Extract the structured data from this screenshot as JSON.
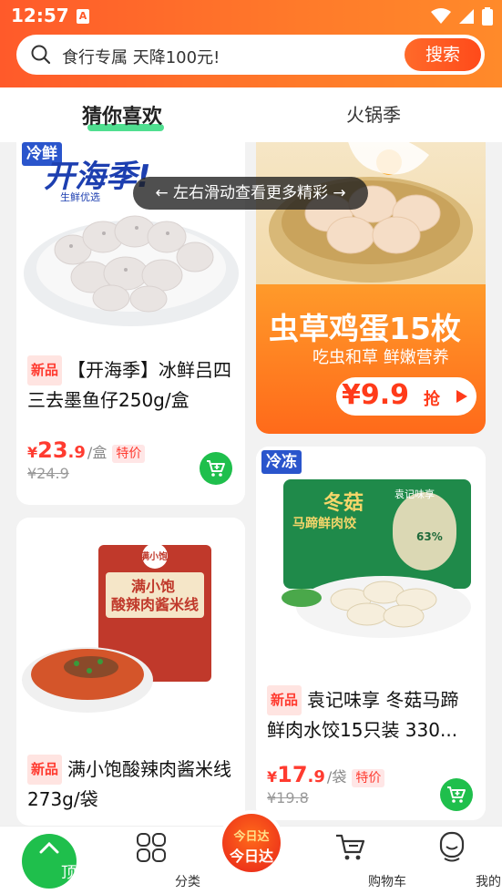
{
  "status_bar": {
    "time": "12:57",
    "app_icon": "A"
  },
  "search": {
    "placeholder": "食行专属 天降100元!",
    "button": "搜索"
  },
  "tabs": [
    {
      "label": "猜你喜欢"
    },
    {
      "label": "火锅季"
    }
  ],
  "swipe_hint": "左右滑动查看更多精彩",
  "products": [
    {
      "badge": "冷鲜",
      "image_text": "开海季!",
      "image_sub": "生鲜优选",
      "new_tag": "新品",
      "title": "【开海季】冰鲜吕四三去墨鱼仔250g/盒",
      "price_currency": "¥",
      "price_int": "23",
      "price_dec": ".9",
      "unit": "/盒",
      "special": "特价",
      "old_price": "¥24.9"
    },
    {
      "banner_title": "虫草鸡蛋15枚",
      "banner_sub": "吃虫和草 鲜嫩营养",
      "banner_price": "¥9.9",
      "banner_cta": "抢"
    },
    {
      "image_brand": "满小饱",
      "image_line1": "满小饱",
      "image_line2": "酸辣肉酱米线",
      "new_tag": "新品",
      "title": "满小饱酸辣肉酱米线273g/袋"
    },
    {
      "badge": "冷冻",
      "image_line1": "冬菇",
      "image_line2": "马蹄鲜肉饺",
      "image_brand": "袁记味享",
      "image_pct": "63%",
      "new_tag": "新品",
      "title": "袁记味享 冬菇马蹄鲜肉水饺15只装 330...",
      "price_currency": "¥",
      "price_int": "17",
      "price_dec": ".9",
      "unit": "/袋",
      "special": "特价",
      "old_price": "¥19.8"
    }
  ],
  "bottom_nav": {
    "top": "顶部",
    "category": "分类",
    "center_line1": "今日达",
    "center_line2": "今日达",
    "cart": "购物车",
    "mine": "我的"
  },
  "colors": {
    "brand_orange": "#ff6a2a",
    "green": "#1fbf4c",
    "price_red": "#ff3b30",
    "badge_blue": "#2a55cc"
  }
}
